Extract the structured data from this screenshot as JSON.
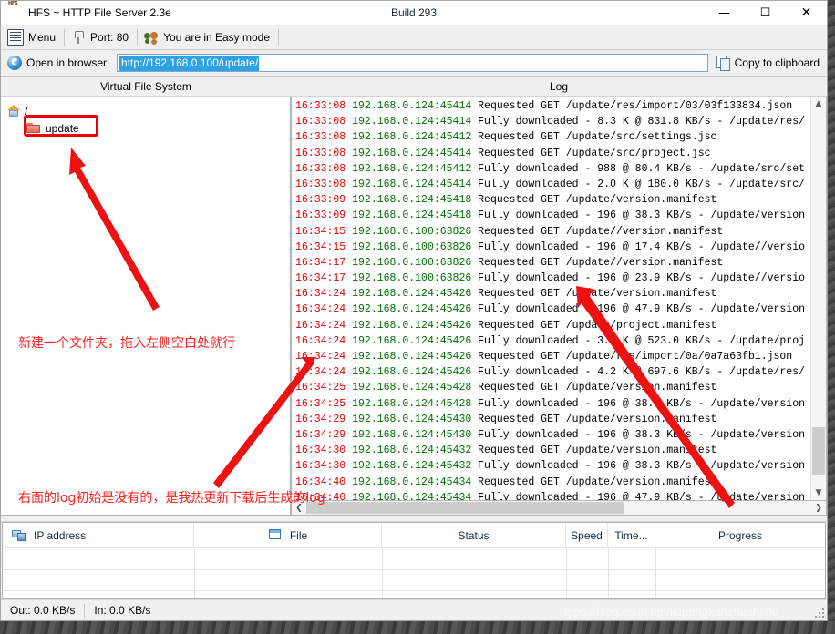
{
  "window": {
    "title": "HFS ~ HTTP File Server 2.3e",
    "build": "Build 293",
    "icon": "hfs-icon",
    "minimize": "—",
    "maximize": "☐",
    "close": "✕"
  },
  "toolbar": {
    "menu_label": "Menu",
    "port_label": "Port: 80",
    "mode_label": "You are in Easy mode",
    "open_in_browser_label": "Open in browser",
    "url_value": "http://192.168.0.100/update/",
    "copy_to_clipboard_label": "Copy to clipboard"
  },
  "panels": {
    "vfs_header": "Virtual File System",
    "log_header": "Log"
  },
  "tree": {
    "root_label": "/",
    "child_label": "update"
  },
  "annotations": {
    "top_note": "新建一个文件夹，拖入左侧空白处就行",
    "bottom_note": "右面的log初始是没有的，是我热更新下载后生成的log",
    "color": "#ff2020",
    "box_color": "#ee0000"
  },
  "log_lines": [
    {
      "time": "16:33:08",
      "addr": "192.168.0.124:45414",
      "msg": "Requested GET /update/res/import/03/03f133834.json"
    },
    {
      "time": "16:33:08",
      "addr": "192.168.0.124:45414",
      "msg": "Fully downloaded - 8.3 K @ 831.8 KB/s - /update/res/"
    },
    {
      "time": "16:33:08",
      "addr": "192.168.0.124:45412",
      "msg": "Requested GET /update/src/settings.jsc"
    },
    {
      "time": "16:33:08",
      "addr": "192.168.0.124:45414",
      "msg": "Requested GET /update/src/project.jsc"
    },
    {
      "time": "16:33:08",
      "addr": "192.168.0.124:45412",
      "msg": "Fully downloaded - 988 @ 80.4 KB/s - /update/src/set"
    },
    {
      "time": "16:33:08",
      "addr": "192.168.0.124:45414",
      "msg": "Fully downloaded - 2.0 K @ 180.0 KB/s - /update/src/"
    },
    {
      "time": "16:33:09",
      "addr": "192.168.0.124:45418",
      "msg": "Requested GET /update/version.manifest"
    },
    {
      "time": "16:33:09",
      "addr": "192.168.0.124:45418",
      "msg": "Fully downloaded - 196 @ 38.3 KB/s - /update/version"
    },
    {
      "time": "16:34:15",
      "addr": "192.168.0.100:63826",
      "msg": "Requested GET /update//version.manifest"
    },
    {
      "time": "16:34:15",
      "addr": "192.168.0.100:63826",
      "msg": "Fully downloaded - 196 @ 17.4 KB/s - /update//versio"
    },
    {
      "time": "16:34:17",
      "addr": "192.168.0.100:63826",
      "msg": "Requested GET /update//version.manifest"
    },
    {
      "time": "16:34:17",
      "addr": "192.168.0.100:63826",
      "msg": "Fully downloaded - 196 @ 23.9 KB/s - /update//versio"
    },
    {
      "time": "16:34:24",
      "addr": "192.168.0.124:45426",
      "msg": "Requested GET /update/version.manifest"
    },
    {
      "time": "16:34:24",
      "addr": "192.168.0.124:45426",
      "msg": "Fully downloaded - 196 @ 47.9 KB/s - /update/version"
    },
    {
      "time": "16:34:24",
      "addr": "192.168.0.124:45426",
      "msg": "Requested GET /update/project.manifest"
    },
    {
      "time": "16:34:24",
      "addr": "192.168.0.124:45426",
      "msg": "Fully downloaded - 3.1 K @ 523.0 KB/s - /update/proj"
    },
    {
      "time": "16:34:24",
      "addr": "192.168.0.124:45426",
      "msg": "Requested GET /update/res/import/0a/0a7a63fb1.json"
    },
    {
      "time": "16:34:24",
      "addr": "192.168.0.124:45426",
      "msg": "Fully downloaded - 4.2 K @ 697.6 KB/s - /update/res/"
    },
    {
      "time": "16:34:25",
      "addr": "192.168.0.124:45428",
      "msg": "Requested GET /update/version.manifest"
    },
    {
      "time": "16:34:25",
      "addr": "192.168.0.124:45428",
      "msg": "Fully downloaded - 196 @ 38.3 KB/s - /update/version"
    },
    {
      "time": "16:34:29",
      "addr": "192.168.0.124:45430",
      "msg": "Requested GET /update/version.manifest"
    },
    {
      "time": "16:34:29",
      "addr": "192.168.0.124:45430",
      "msg": "Fully downloaded - 196 @ 38.3 KB/s - /update/version"
    },
    {
      "time": "16:34:30",
      "addr": "192.168.0.124:45432",
      "msg": "Requested GET /update/version.manifest"
    },
    {
      "time": "16:34:30",
      "addr": "192.168.0.124:45432",
      "msg": "Fully downloaded - 196 @ 38.3 KB/s - /update/version"
    },
    {
      "time": "16:34:40",
      "addr": "192.168.0.124:45434",
      "msg": "Requested GET /update/version.manifest"
    },
    {
      "time": "16:34:40",
      "addr": "192.168.0.124:45434",
      "msg": "Fully downloaded - 196 @ 47.9 KB/s - /update/version"
    }
  ],
  "transfers": {
    "columns": [
      "IP address",
      "File",
      "Status",
      "Speed",
      "Time...",
      "Progress"
    ]
  },
  "status": {
    "out": "Out: 0.0 KB/s",
    "in": "In: 0.0 KB/s"
  },
  "watermark": "https://blog.csdn.net/liupengxunzhuanshu"
}
